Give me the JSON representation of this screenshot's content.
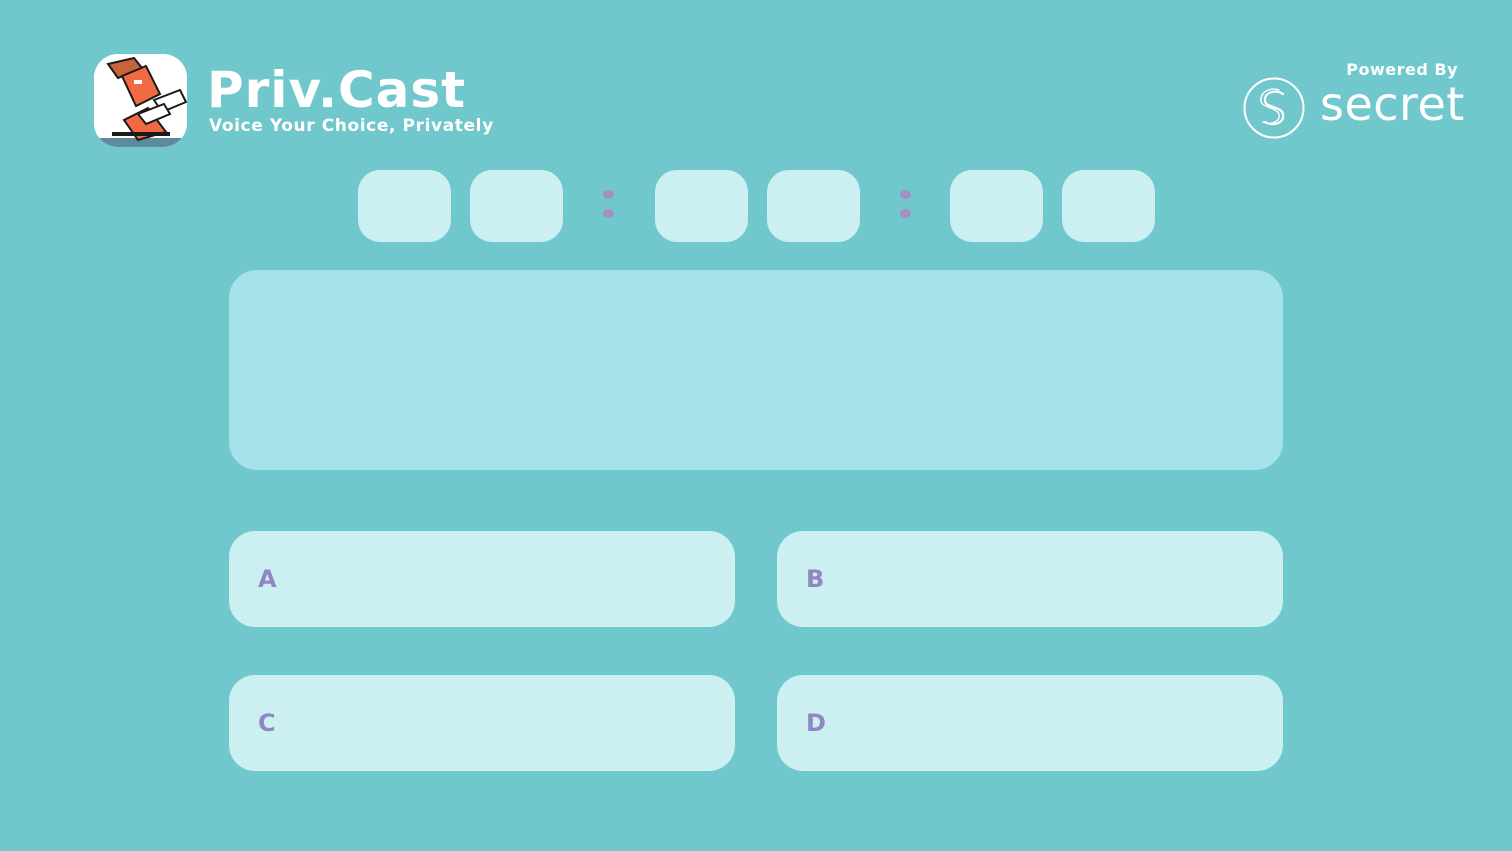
{
  "header": {
    "title": "Priv.Cast",
    "tagline": "Voice Your Choice, Privately",
    "powered_by": "Powered By",
    "partner_name": "secret",
    "logo_icon": "ballot-hands-icon",
    "partner_icon": "secret-network-icon"
  },
  "timer": {
    "digits": [
      "",
      "",
      "",
      "",
      "",
      ""
    ],
    "separator": ":"
  },
  "question": {
    "text": ""
  },
  "options": [
    {
      "letter": "A",
      "text": ""
    },
    {
      "letter": "B",
      "text": ""
    },
    {
      "letter": "C",
      "text": ""
    },
    {
      "letter": "D",
      "text": ""
    }
  ],
  "colors": {
    "background": "#71c8cc",
    "card": "#ccf0f2",
    "question_card": "#a6e2e9",
    "accent_text": "#8f86c2",
    "colon_dot": "#a48fc2",
    "white": "#ffffff"
  }
}
